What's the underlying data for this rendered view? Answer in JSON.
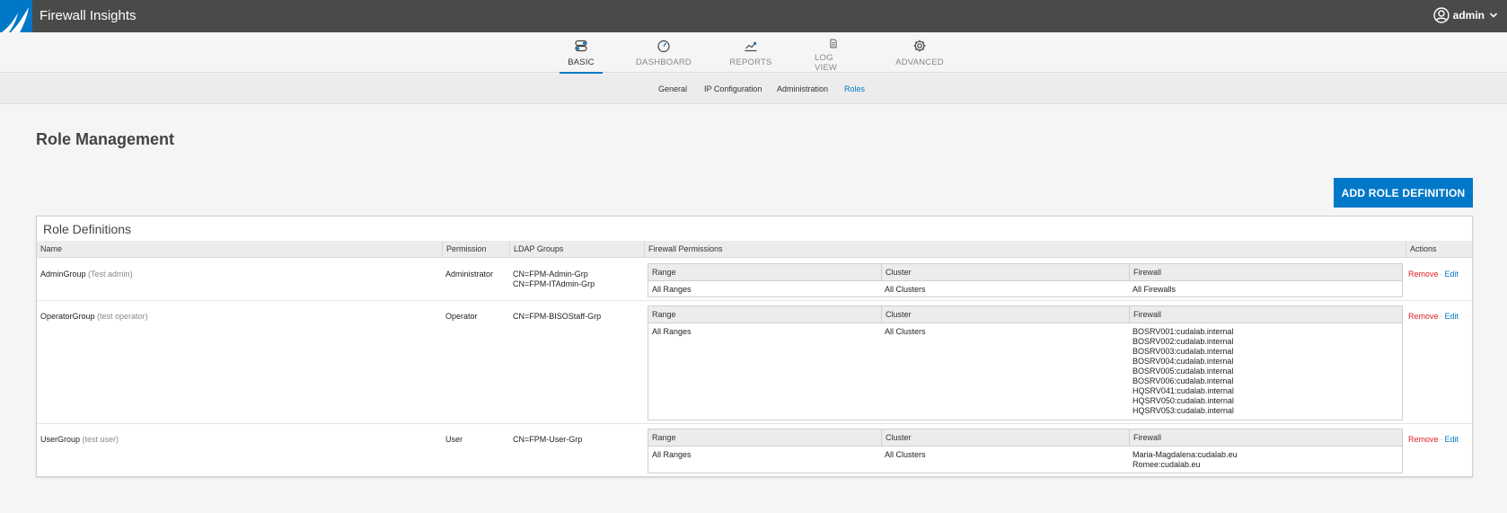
{
  "app": {
    "title": "Firewall Insights"
  },
  "user": {
    "name": "admin"
  },
  "main_nav": [
    {
      "label": "BASIC",
      "icon": "toggle-icon",
      "active": true
    },
    {
      "label": "DASHBOARD",
      "icon": "gauge-icon",
      "active": false
    },
    {
      "label": "REPORTS",
      "icon": "chart-icon",
      "active": false
    },
    {
      "label": "LOG VIEW",
      "icon": "document-icon",
      "active": false
    },
    {
      "label": "ADVANCED",
      "icon": "gear-icon",
      "active": false
    }
  ],
  "sub_nav": [
    {
      "label": "General",
      "active": false
    },
    {
      "label": "IP Configuration",
      "active": false
    },
    {
      "label": "Administration",
      "active": false
    },
    {
      "label": "Roles",
      "active": true
    }
  ],
  "page": {
    "title": "Role Management",
    "add_button": "ADD ROLE DEFINITION"
  },
  "panel": {
    "title": "Role Definitions",
    "columns": {
      "name": "Name",
      "permission": "Permission",
      "ldap": "LDAP Groups",
      "fw_permissions": "Firewall Permissions",
      "actions": "Actions"
    },
    "fw_columns": {
      "range": "Range",
      "cluster": "Cluster",
      "firewall": "Firewall"
    },
    "actions": {
      "remove": "Remove",
      "sep": "·",
      "edit": "Edit"
    }
  },
  "roles": [
    {
      "name": "AdminGroup",
      "description": "(Test admin)",
      "permission": "Administrator",
      "ldap": [
        "CN=FPM-Admin-Grp",
        "CN=FPM-ITAdmin-Grp"
      ],
      "range": "All Ranges",
      "cluster": "All Clusters",
      "firewalls": [
        "All Firewalls"
      ]
    },
    {
      "name": "OperatorGroup",
      "description": "(test operator)",
      "permission": "Operator",
      "ldap": [
        "CN=FPM-BISOStaff-Grp"
      ],
      "range": "All Ranges",
      "cluster": "All Clusters",
      "firewalls": [
        "BOSRV001:cudalab.internal",
        "BOSRV002:cudalab.internal",
        "BOSRV003:cudalab.internal",
        "BOSRV004:cudalab.internal",
        "BOSRV005:cudalab.internal",
        "BOSRV006:cudalab.internal",
        "HQSRV041:cudalab.internal",
        "HQSRV050:cudalab.internal",
        "HQSRV053:cudalab.internal"
      ]
    },
    {
      "name": "UserGroup",
      "description": "(test user)",
      "permission": "User",
      "ldap": [
        "CN=FPM-User-Grp"
      ],
      "range": "All Ranges",
      "cluster": "All Clusters",
      "firewalls": [
        "Maria-Magdalena:cudalab.eu",
        "Romee:cudalab.eu"
      ]
    }
  ],
  "colors": {
    "accent": "#0078c8",
    "topbar": "#4a4a4a",
    "remove": "#dd2222"
  }
}
